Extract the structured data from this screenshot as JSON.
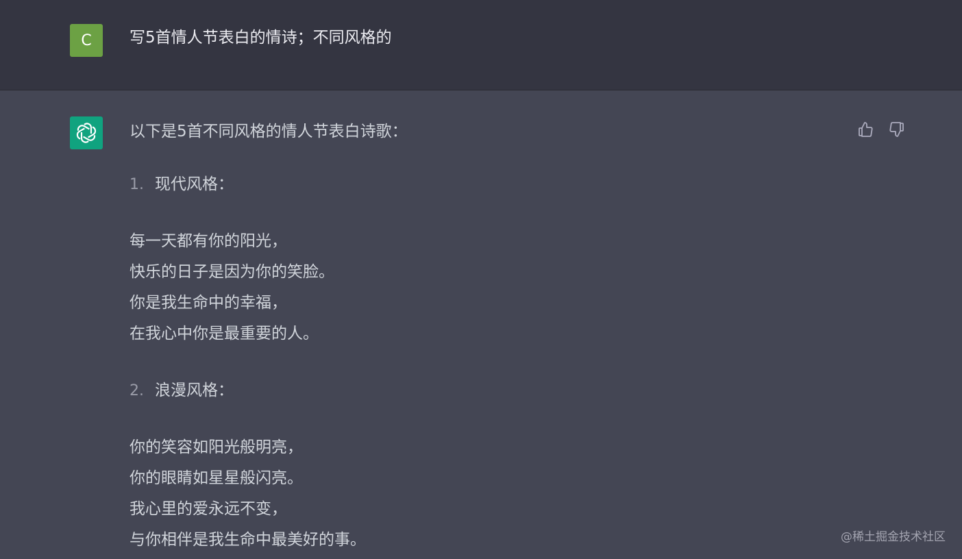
{
  "user": {
    "avatar_letter": "C",
    "avatar_color": "#6ca144",
    "message": "写5首情人节表白的情诗；不同风格的"
  },
  "assistant": {
    "avatar_color": "#10a37f",
    "avatar_icon": "openai-logo-icon",
    "intro": "以下是5首不同风格的情人节表白诗歌：",
    "poems": [
      {
        "number": "1.",
        "title": "现代风格：",
        "lines": [
          "每一天都有你的阳光，",
          "快乐的日子是因为你的笑脸。",
          "你是我生命中的幸福，",
          "在我心中你是最重要的人。"
        ]
      },
      {
        "number": "2.",
        "title": "浪漫风格：",
        "lines": [
          "你的笑容如阳光般明亮，",
          "你的眼睛如星星般闪亮。",
          "我心里的爱永远不变，",
          "与你相伴是我生命中最美好的事。"
        ]
      }
    ],
    "feedback": {
      "like_icon": "thumbs-up-icon",
      "dislike_icon": "thumbs-down-icon"
    }
  },
  "watermark": "@稀土掘金技术社区",
  "colors": {
    "user_bg": "#343541",
    "assistant_bg": "#444654",
    "text": "#ececf1"
  }
}
